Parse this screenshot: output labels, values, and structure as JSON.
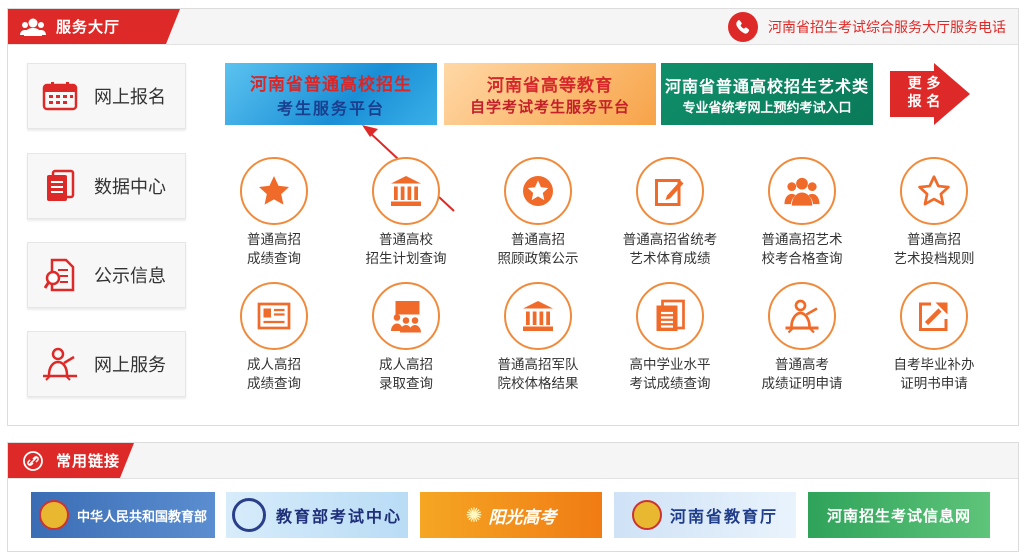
{
  "header": {
    "section_title": "服务大厅",
    "hotline_label": "河南省招生考试综合服务大厅服务电话"
  },
  "sidebar": {
    "items": [
      {
        "label": "网上报名",
        "icon": "calendar-icon"
      },
      {
        "label": "数据中心",
        "icon": "document-stack-icon"
      },
      {
        "label": "公示信息",
        "icon": "document-search-icon"
      },
      {
        "label": "网上服务",
        "icon": "person-at-desk-icon"
      }
    ]
  },
  "banners": [
    {
      "line1": "河南省普通高校招生",
      "line2": "考生服务平台"
    },
    {
      "line1": "河南省高等教育",
      "line2": "自学考试考生服务平台"
    },
    {
      "line1": "河南省普通高校招生艺术类",
      "line2": "专业省统考网上预约考试入口"
    }
  ],
  "more_button": {
    "line1": "更 多",
    "line2": "报 名"
  },
  "grid": {
    "row1": [
      {
        "line1": "普通高招",
        "line2": "成绩查询",
        "icon": "star-filled-icon"
      },
      {
        "line1": "普通高校",
        "line2": "招生计划查询",
        "icon": "building-icon"
      },
      {
        "line1": "普通高招",
        "line2": "照顾政策公示",
        "icon": "star-badge-icon"
      },
      {
        "line1": "普通高招省统考",
        "line2": "艺术体育成绩",
        "icon": "edit-icon"
      },
      {
        "line1": "普通高招艺术",
        "line2": "校考合格查询",
        "icon": "group-icon"
      },
      {
        "line1": "普通高招",
        "line2": "艺术投档规则",
        "icon": "star-outline-icon"
      }
    ],
    "row2": [
      {
        "line1": "成人高招",
        "line2": "成绩查询",
        "icon": "certificate-icon"
      },
      {
        "line1": "成人高招",
        "line2": "录取查询",
        "icon": "presentation-icon"
      },
      {
        "line1": "普通高招军队",
        "line2": "院校体格结果",
        "icon": "building-icon"
      },
      {
        "line1": "高中学业水平",
        "line2": "考试成绩查询",
        "icon": "document-list-icon"
      },
      {
        "line1": "普通高考",
        "line2": "成绩证明申请",
        "icon": "teacher-icon"
      },
      {
        "line1": "自考毕业补办",
        "line2": "证明书申请",
        "icon": "arrow-out-icon"
      }
    ]
  },
  "links_section": {
    "title": "常用链接"
  },
  "links": [
    {
      "label": "中华人民共和国教育部"
    },
    {
      "label": "教育部考试中心"
    },
    {
      "label": "阳光高考"
    },
    {
      "label": "河南省教育厅"
    },
    {
      "label": "河南招生考试信息网"
    }
  ],
  "colors": {
    "accent": "#dd2a28",
    "icon_orange": "#f08a3c"
  }
}
